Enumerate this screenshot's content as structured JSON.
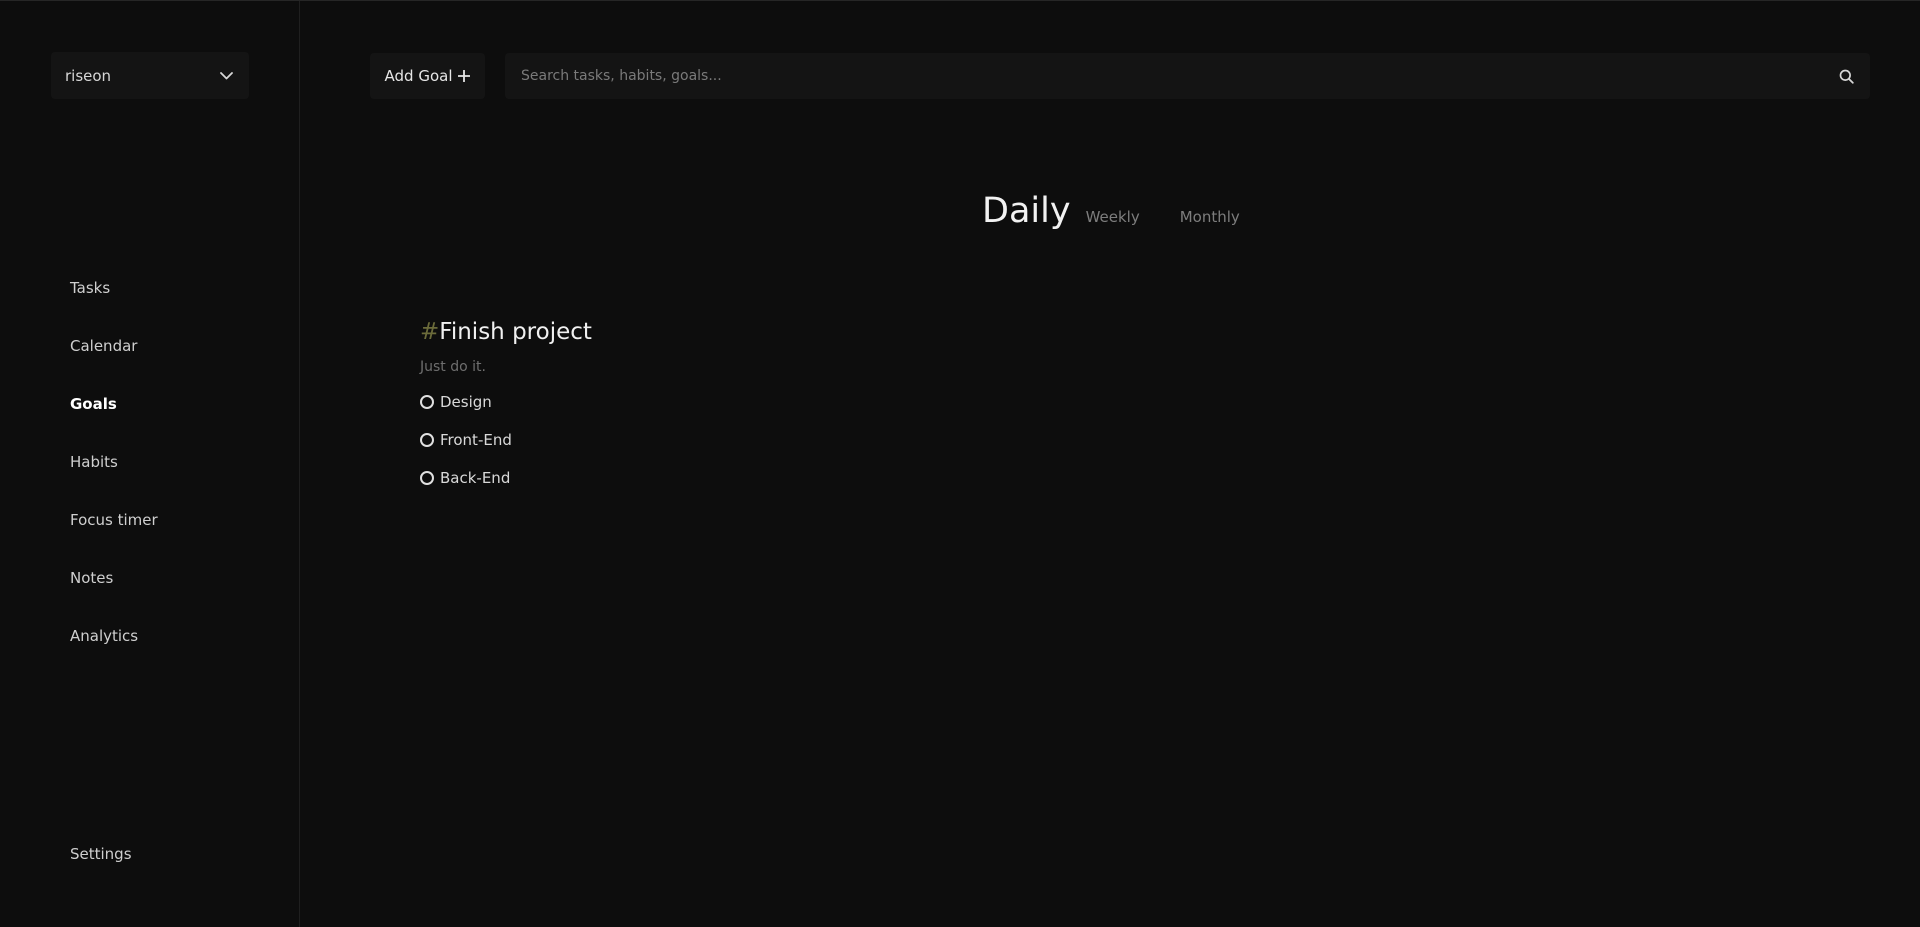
{
  "sidebar": {
    "workspace": "riseon",
    "items": [
      {
        "label": "Tasks"
      },
      {
        "label": "Calendar"
      },
      {
        "label": "Goals",
        "active": true
      },
      {
        "label": "Habits"
      },
      {
        "label": "Focus timer"
      },
      {
        "label": "Notes"
      },
      {
        "label": "Analytics"
      }
    ],
    "settings": "Settings"
  },
  "toolbar": {
    "add_goal_label": "Add Goal",
    "search_placeholder": "Search tasks, habits, goals..."
  },
  "tabs": {
    "daily": "Daily",
    "weekly": "Weekly",
    "monthly": "Monthly",
    "active": "daily"
  },
  "goal": {
    "hash": "#",
    "title": "Finish project",
    "description": "Just do it.",
    "subtasks": [
      {
        "label": "Design",
        "done": false
      },
      {
        "label": "Front-End",
        "done": false
      },
      {
        "label": "Back-End",
        "done": false
      }
    ]
  },
  "colors": {
    "background": "#0d0d0d",
    "surface": "#141414",
    "hash_accent": "#6b6b3a"
  }
}
